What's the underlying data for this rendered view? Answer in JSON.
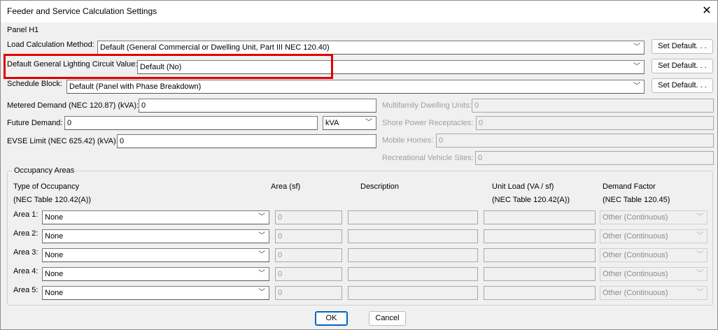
{
  "window": {
    "title": "Feeder and Service Calculation Settings"
  },
  "panel_name": "Panel H1",
  "load_calc": {
    "label": "Load Calculation Method:",
    "value": "Default (General Commercial or Dwelling Unit, Part III  NEC 120.40)",
    "button": "Set Default. . ."
  },
  "lighting": {
    "label": "Default General Lighting Circuit Value:",
    "value": "Default (No)",
    "button": "Set Default. . ."
  },
  "schedule": {
    "label": "Schedule Block:",
    "value": "Default (Panel with Phase Breakdown)",
    "button": "Set Default. . ."
  },
  "metered": {
    "label": "Metered Demand (NEC 120.87) (kVA):",
    "value": "0"
  },
  "future": {
    "label": "Future Demand:",
    "value": "0",
    "unit": "kVA"
  },
  "evse": {
    "label": "EVSE Limit (NEC 625.42) (kVA):",
    "value": "0"
  },
  "right_fields": [
    {
      "label": "Multifamily Dwelling Units:",
      "value": "0"
    },
    {
      "label": "Shore Power Receptacles:",
      "value": "0"
    },
    {
      "label": "Mobile Homes:",
      "value": "0"
    },
    {
      "label": "Recreational Vehicle Sites:",
      "value": "0"
    }
  ],
  "occupancy": {
    "group_label": "Occupancy Areas",
    "headers": {
      "type_line1": "Type of Occupancy",
      "type_line2": "(NEC Table 120.42(A))",
      "area": "Area (sf)",
      "description": "Description",
      "unit_line1": "Unit Load (VA / sf)",
      "unit_line2": "(NEC Table 120.42(A))",
      "demand_line1": "Demand Factor",
      "demand_line2": "(NEC Table 120.45)"
    },
    "rows": [
      {
        "label": "Area 1:",
        "type": "None",
        "area": "0",
        "description": "",
        "unit_load": "",
        "demand": "Other (Continuous)"
      },
      {
        "label": "Area 2:",
        "type": "None",
        "area": "0",
        "description": "",
        "unit_load": "",
        "demand": "Other (Continuous)"
      },
      {
        "label": "Area 3:",
        "type": "None",
        "area": "0",
        "description": "",
        "unit_load": "",
        "demand": "Other (Continuous)"
      },
      {
        "label": "Area 4:",
        "type": "None",
        "area": "0",
        "description": "",
        "unit_load": "",
        "demand": "Other (Continuous)"
      },
      {
        "label": "Area 5:",
        "type": "None",
        "area": "0",
        "description": "",
        "unit_load": "",
        "demand": "Other (Continuous)"
      }
    ]
  },
  "footer": {
    "ok": "OK",
    "cancel": "Cancel"
  },
  "icons": {
    "close": "close-icon",
    "dropdown": "chevron-down-icon"
  },
  "colors": {
    "highlight": "#e00000",
    "primary_border": "#0067c0",
    "background": "#f0f0f0"
  }
}
